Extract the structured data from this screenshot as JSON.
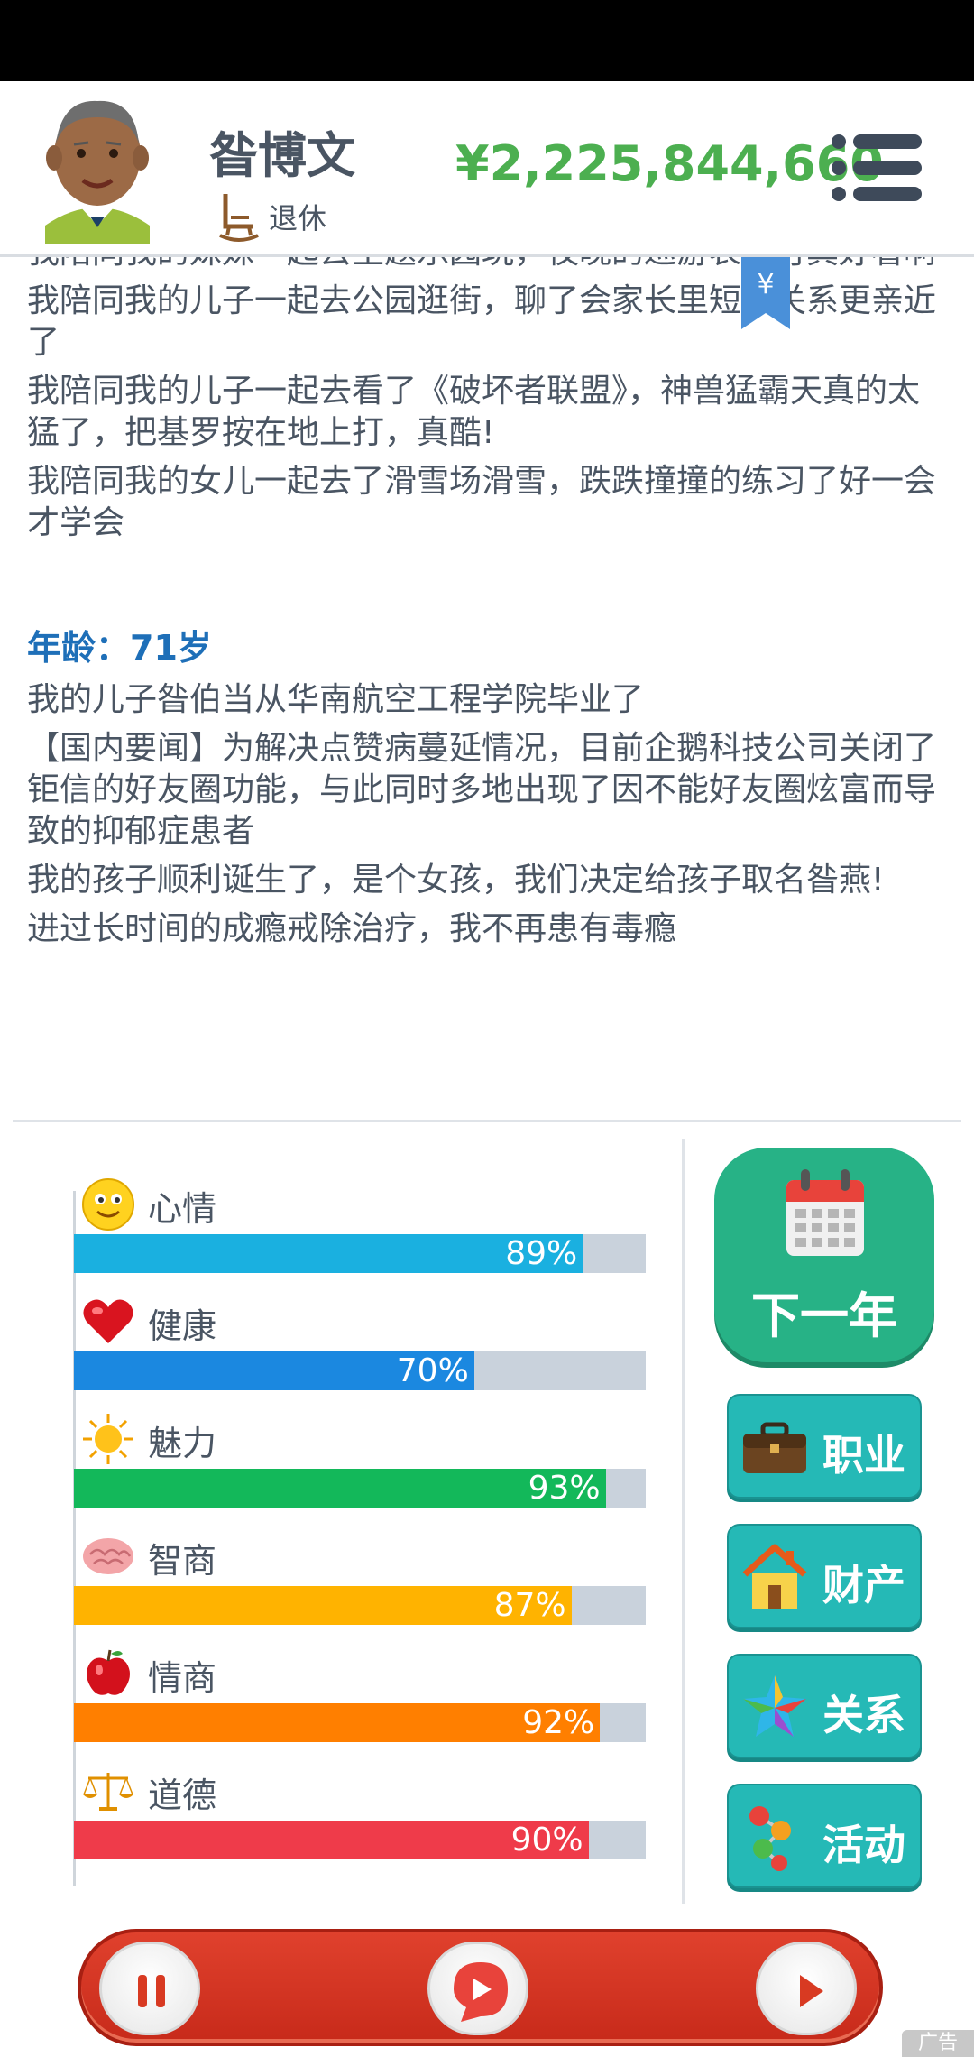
{
  "player": {
    "name": "昝博文",
    "status": "退休",
    "money": "¥2,225,844,660"
  },
  "log": {
    "entries_top": [
      "我陪同我的妹妹一起去主题乐园玩，夜晚的巡游表演可真好看啊",
      "我陪同我的儿子一起去公园逛街，聊了会家长里短，关系更亲近了",
      "我陪同我的儿子一起去看了《破坏者联盟》，神兽猛霸天真的太猛了，把基罗按在地上打，真酷!",
      "我陪同我的女儿一起去了滑雪场滑雪，跌跌撞撞的练习了好一会才学会"
    ],
    "age_label": "年龄：71岁",
    "entries_bottom": [
      "我的儿子昝伯当从华南航空工程学院毕业了",
      "【国内要闻】为解决点赞病蔓延情况，目前企鹅科技公司关闭了钜信的好友圈功能，与此同时多地出现了因不能好友圈炫富而导致的抑郁症患者",
      "我的孩子顺利诞生了，是个女孩，我们决定给孩子取名昝燕!",
      "进过长时间的成瘾戒除治疗，我不再患有毒瘾"
    ],
    "bookmark_symbol": "¥"
  },
  "stats": [
    {
      "label": "心情",
      "value": 89,
      "pct": "89%",
      "color": "#1ab0e0",
      "icon": "smiley-icon"
    },
    {
      "label": "健康",
      "value": 70,
      "pct": "70%",
      "color": "#1b88e0",
      "icon": "heart-icon"
    },
    {
      "label": "魅力",
      "value": 93,
      "pct": "93%",
      "color": "#13b85a",
      "icon": "sun-icon"
    },
    {
      "label": "智商",
      "value": 87,
      "pct": "87%",
      "color": "#ffb300",
      "icon": "brain-icon"
    },
    {
      "label": "情商",
      "value": 92,
      "pct": "92%",
      "color": "#ff7f00",
      "icon": "apple-icon"
    },
    {
      "label": "道德",
      "value": 90,
      "pct": "90%",
      "color": "#ef3b4a",
      "icon": "scales-icon"
    }
  ],
  "actions": {
    "next_year": "下一年",
    "career": "职业",
    "property": "财产",
    "relations": "关系",
    "activities": "活动"
  },
  "ad": {
    "label": "广告"
  }
}
